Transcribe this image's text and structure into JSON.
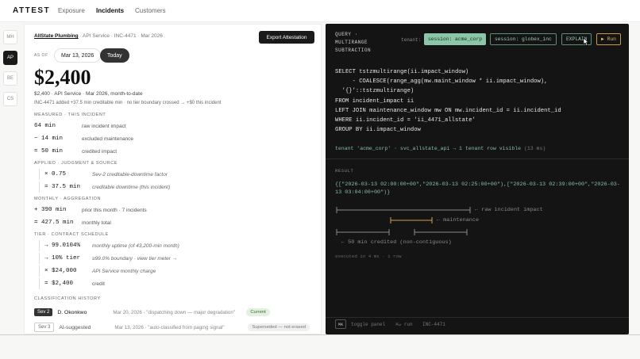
{
  "nav": {
    "brand": "ATTEST",
    "links": [
      "Exposure",
      "Incidents",
      "Customers"
    ],
    "active": "Incidents"
  },
  "rail": [
    "MH",
    "AP",
    "BE",
    "CS"
  ],
  "rail_active": "AP",
  "header": {
    "customer": "AllState Plumbing",
    "crumb_rest": "· API Service · INC-4471 · Mar 2026",
    "export_label": "Export Attestation",
    "asof_label": "AS OF",
    "asof_date": "Mar 13, 2026",
    "today_label": "Today"
  },
  "summary": {
    "amount": "$2,400",
    "line1": "$2,400 · API Service · Mar 2026, month-to-date",
    "line2": "INC-4471 added +37.5 min creditable min · no tier boundary crossed → +$0 this incident"
  },
  "sections": {
    "measured": {
      "title": "MEASURED · THIS INCIDENT",
      "rows": [
        {
          "value": "64 min",
          "desc": "raw incident impact"
        },
        {
          "value": "− 14 min",
          "desc": "excluded maintenance"
        },
        {
          "value": "= 50 min",
          "desc": "credited impact"
        }
      ]
    },
    "applied": {
      "title": "APPLIED · JUDGMENT & SOURCE",
      "rows": [
        {
          "value": "× 0.75",
          "desc": "Sev-2 creditable-downtime factor"
        },
        {
          "value": "= 37.5 min",
          "desc": "creditable downtime (this incident)"
        }
      ]
    },
    "monthly": {
      "title": "MONTHLY · AGGREGATION",
      "rows": [
        {
          "value": "+ 390 min",
          "desc": "prior this month · 7 incidents"
        },
        {
          "value": "= 427.5 min",
          "desc": "monthly total"
        }
      ]
    },
    "tier": {
      "title": "TIER · CONTRACT SCHEDULE",
      "rows": [
        {
          "value": "→ 99.0104%",
          "desc": "monthly uptime (of 43,200-min month)"
        },
        {
          "value": "→ 10% tier",
          "desc": "≥99.0% boundary · view tier meter →"
        },
        {
          "value": "× $24,000",
          "desc": "API Service monthly charge"
        },
        {
          "value": "= $2,400",
          "desc": "credit"
        }
      ]
    },
    "history": {
      "title": "CLASSIFICATION HISTORY",
      "rows": [
        {
          "sev": "Sev 2",
          "who": "D. Okonkwo",
          "when": "Mar 20, 2026 · \"dispatching down — major degradation\"",
          "badge": "Current"
        },
        {
          "sev": "Sev 3",
          "who": "AI-suggested",
          "when": "Mar 13, 2026 · \"auto-classified from paging signal\"",
          "badge": "Superseded — not erased"
        }
      ]
    }
  },
  "console": {
    "query_label": "QUERY ·\nMULTIRANGE\nSUBTRACTION",
    "tenant_label": "tenant:",
    "tenants": [
      "session: acme_corp",
      "session: globex_inc"
    ],
    "active_tenant": "session: acme_corp",
    "explain_label": "EXPLAIN",
    "run_label": "▶ Run",
    "sql": [
      "SELECT tstzmultirange(ii.impact_window)",
      "     - COALESCE(range_agg(mw.maint_window * ii.impact_window),",
      "  '{}'::tstzmultirange)",
      "FROM incident_impact ii",
      "LEFT JOIN maintenance_window mw ON mw.incident_id = ii.incident_id",
      "WHERE ii.incident_id = 'ii_4471_allstate'",
      "GROUP BY ii.impact_window"
    ],
    "meta": "tenant 'acme_corp' · svc_allstate_api → 1 tenant row visible",
    "meta_time": "(13 ms)",
    "result_label": "RESULT",
    "result": "{[\"2026-03-13 02:00:00+00\",\"2026-03-13 02:25:00+00\"),[\"2026-03-13 02:39:00+00\",\"2026-03-13 03:04:00+00\")}",
    "viz": {
      "raw_label": "← raw incident impact",
      "maint_label": "← maintenance",
      "credited_label": "← 50 min credited (non-contiguous)",
      "raw_color": "#8a8a8a",
      "maint_color": "#d4a24a",
      "credited_color": "#8a8a8a"
    },
    "exec": "executed in 4 ms · 1 row",
    "shortcut_key": "⌘K",
    "toggle_hint": "toggle panel",
    "run_hint": "⌘↵ run",
    "incident_hint": "INC-4471"
  }
}
